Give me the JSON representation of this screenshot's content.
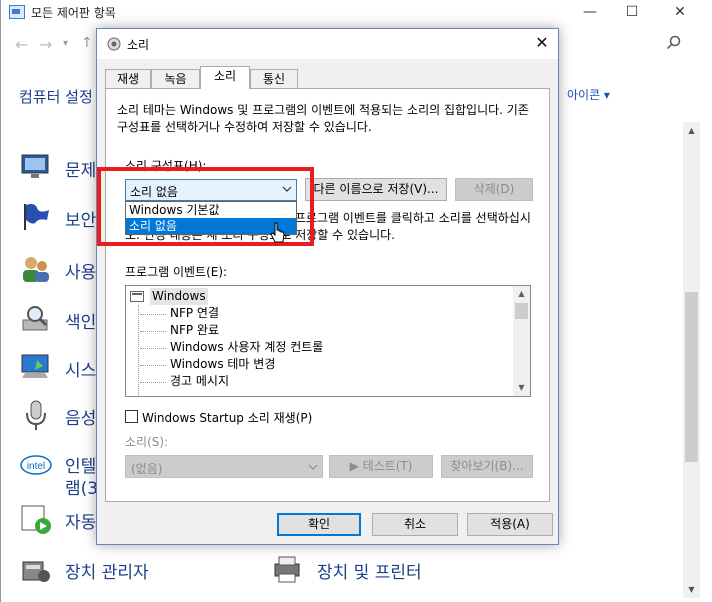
{
  "background_window": {
    "title": "모든 제어판 항목",
    "minimize": "—",
    "maximize": "☐",
    "close": "✕",
    "header": "컴퓨터 설정",
    "view_by": "아이콘 ▾",
    "items": [
      {
        "label": "문제",
        "label2": ""
      },
      {
        "label": "보안",
        "label2": ""
      },
      {
        "label": "사용",
        "label2": ""
      },
      {
        "label": "색인",
        "label2": ""
      },
      {
        "label": "시스",
        "label2": ""
      },
      {
        "label": "음성",
        "label2": ""
      },
      {
        "label": "인텔",
        "label2": "램(32"
      },
      {
        "label": "자동",
        "label2": ""
      },
      {
        "label": "장치 관리자",
        "label2": ""
      }
    ],
    "right_item": "장치 및 프린터"
  },
  "dialog": {
    "title": "소리",
    "close": "✕",
    "tabs": [
      "재생",
      "녹음",
      "소리",
      "통신"
    ],
    "active_tab": "소리",
    "description": "소리 테마는 Windows 및 프로그램의 이벤트에 적용되는 소리의 집합입니다. 기존 구성표를 선택하거나 수정하여 저장할 수 있습니다.",
    "scheme_label": "소리 구성표(H):",
    "scheme_value": "소리 없음",
    "scheme_options": [
      "Windows 기본값",
      "소리 없음"
    ],
    "selected_option": "소리 없음",
    "save_as_label": "다른 이름으로 저장(V)...",
    "delete_label": "삭제(D)",
    "description2": "소리를 변경하려면 다음 목록에서 프로그램 이벤트를 클릭하고 소리를 선택하십시오. 변경 내용은 새 소리 구성표로 저장할 수 있습니다.",
    "events_label": "프로그램 이벤트(E):",
    "event_root": "Windows",
    "events": [
      "NFP 연결",
      "NFP 완료",
      "Windows 사용자 계정 컨트롤",
      "Windows 테마 변경",
      "경고 메시지"
    ],
    "startup_label": "Windows Startup 소리 재생(P)",
    "startup_checked": false,
    "sound_label": "소리(S):",
    "sound_value": "(없음)",
    "test_label": "▶ 테스트(T)",
    "browse_label": "찾아보기(B)...",
    "ok_label": "확인",
    "cancel_label": "취소",
    "apply_label": "적용(A)"
  },
  "colors": {
    "highlight": "#e81d1d",
    "selection": "#0078d7",
    "link": "#1e3f8a"
  }
}
